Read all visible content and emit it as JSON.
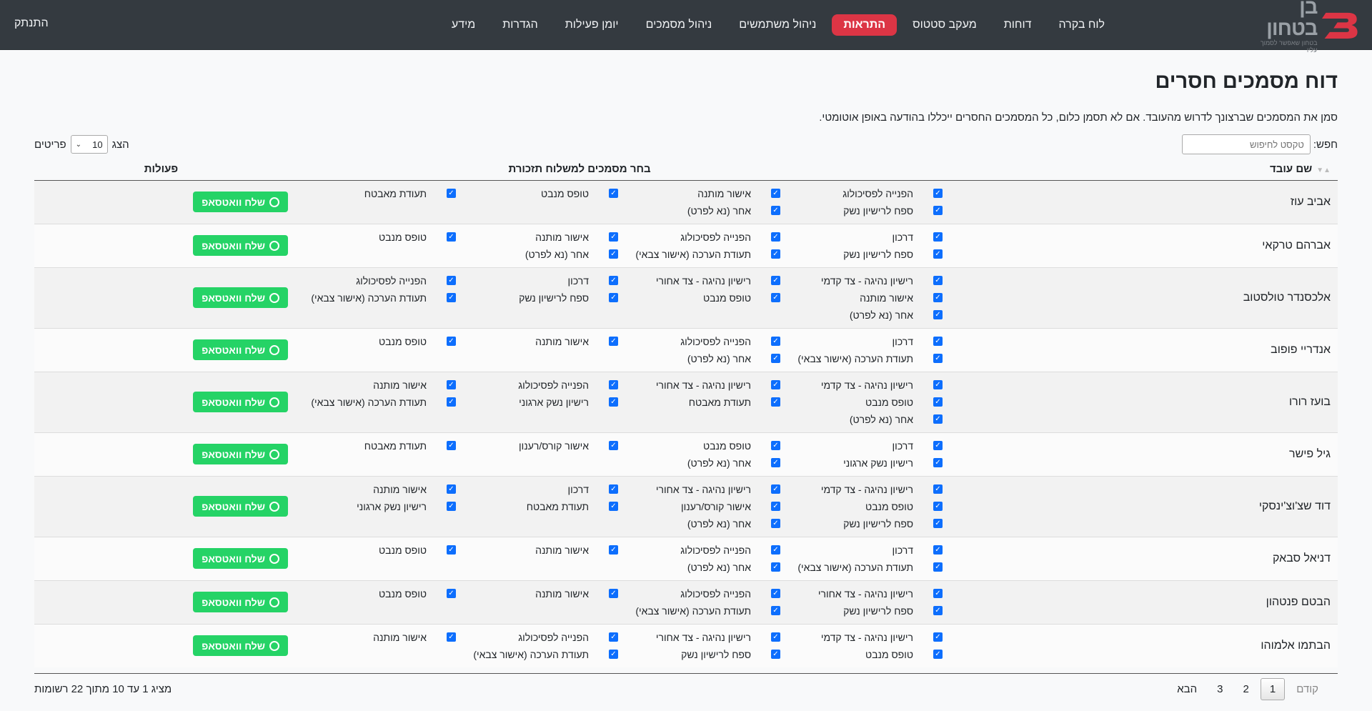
{
  "logo": {
    "title": "בן בטחון",
    "subtitle": "בטחון שאפשר לסמוך עליו",
    "accent": "#dc3545"
  },
  "nav": {
    "items": [
      {
        "label": "לוח בקרה",
        "active": false
      },
      {
        "label": "דוחות",
        "active": false
      },
      {
        "label": "מעקב סטטוס",
        "active": false
      },
      {
        "label": "התראות",
        "active": true
      },
      {
        "label": "ניהול משתמשים",
        "active": false
      },
      {
        "label": "ניהול מסמכים",
        "active": false
      },
      {
        "label": "יומן פעילות",
        "active": false
      },
      {
        "label": "הגדרות",
        "active": false
      },
      {
        "label": "מידע",
        "active": false
      }
    ],
    "logout": "התנתק"
  },
  "page": {
    "title": "דוח מסמכים חסרים",
    "instructions": "סמן את המסמכים שברצונך לדרוש מהעובד. אם לא תסמן כלום, כל המסמכים החסרים ייכללו בהודעה באופן אוטומטי."
  },
  "search": {
    "label": "חפש:",
    "placeholder": "טקסט לחיפוש"
  },
  "length": {
    "prefix": "הצג",
    "value": "10",
    "suffix": "פריטים"
  },
  "table": {
    "headers": {
      "name": "שם עובד",
      "docs": "בחר מסמכים למשלוח תזכורת",
      "actions": "פעולות"
    },
    "button_label": "שלח וואטסאפ",
    "rows": [
      {
        "name": "אביב עוז",
        "docs": [
          "הפנייה לפסיכולוג",
          "אישור מותנה",
          "טופס מנבט",
          "תעודת מאבטח",
          "ספח לרישיון נשק",
          "אחר (נא לפרט)"
        ]
      },
      {
        "name": "אברהם טרקאי",
        "docs": [
          "דרכון",
          "הפנייה לפסיכולוג",
          "אישור מותנה",
          "טופס מנבט",
          "ספח לרישיון נשק",
          "תעודת הערכה (אישור צבאי)",
          "אחר (נא לפרט)"
        ]
      },
      {
        "name": "אלכסנדר טולסטוב",
        "docs": [
          "רישיון נהיגה - צד קדמי",
          "רישיון נהיגה - צד אחורי",
          "דרכון",
          "הפנייה לפסיכולוג",
          "אישור מותנה",
          "טופס מנבט",
          "ספח לרישיון נשק",
          "תעודת הערכה (אישור צבאי)",
          "אחר (נא לפרט)"
        ]
      },
      {
        "name": "אנדריי פופוב",
        "docs": [
          "דרכון",
          "הפנייה לפסיכולוג",
          "אישור מותנה",
          "טופס מנבט",
          "תעודת הערכה (אישור צבאי)",
          "אחר (נא לפרט)"
        ]
      },
      {
        "name": "בועז רורו",
        "docs": [
          "רישיון נהיגה - צד קדמי",
          "רישיון נהיגה - צד אחורי",
          "הפנייה לפסיכולוג",
          "אישור מותנה",
          "טופס מנבט",
          "תעודת מאבטח",
          "רישיון נשק ארגוני",
          "תעודת הערכה (אישור צבאי)",
          "אחר (נא לפרט)"
        ]
      },
      {
        "name": "גיל פישר",
        "docs": [
          "דרכון",
          "טופס מנבט",
          "אישור קורס/רענון",
          "תעודת מאבטח",
          "רישיון נשק ארגוני",
          "אחר (נא לפרט)"
        ]
      },
      {
        "name": "דוד שצ'וצ'ינסקי",
        "docs": [
          "רישיון נהיגה - צד קדמי",
          "רישיון נהיגה - צד אחורי",
          "דרכון",
          "אישור מותנה",
          "טופס מנבט",
          "אישור קורס/רענון",
          "תעודת מאבטח",
          "רישיון נשק ארגוני",
          "ספח לרישיון נשק",
          "אחר (נא לפרט)"
        ]
      },
      {
        "name": "דניאל סבאק",
        "docs": [
          "דרכון",
          "הפנייה לפסיכולוג",
          "אישור מותנה",
          "טופס מנבט",
          "תעודת הערכה (אישור צבאי)",
          "אחר (נא לפרט)"
        ]
      },
      {
        "name": "הבטם פנטהון",
        "docs": [
          "רישיון נהיגה - צד אחורי",
          "הפנייה לפסיכולוג",
          "אישור מותנה",
          "טופס מנבט",
          "ספח לרישיון נשק",
          "תעודת הערכה (אישור צבאי)"
        ]
      },
      {
        "name": "הבתמו אלמוהו",
        "docs": [
          "רישיון נהיגה - צד קדמי",
          "רישיון נהיגה - צד אחורי",
          "הפנייה לפסיכולוג",
          "אישור מותנה",
          "טופס מנבט",
          "ספח לרישיון נשק",
          "תעודת הערכה (אישור צבאי)"
        ]
      }
    ]
  },
  "footer": {
    "info": "מציג 1 עד 10 מתוך 22 רשומות",
    "pagination": {
      "prev": "קודם",
      "pages": [
        "1",
        "2",
        "3"
      ],
      "next": "הבא"
    }
  }
}
